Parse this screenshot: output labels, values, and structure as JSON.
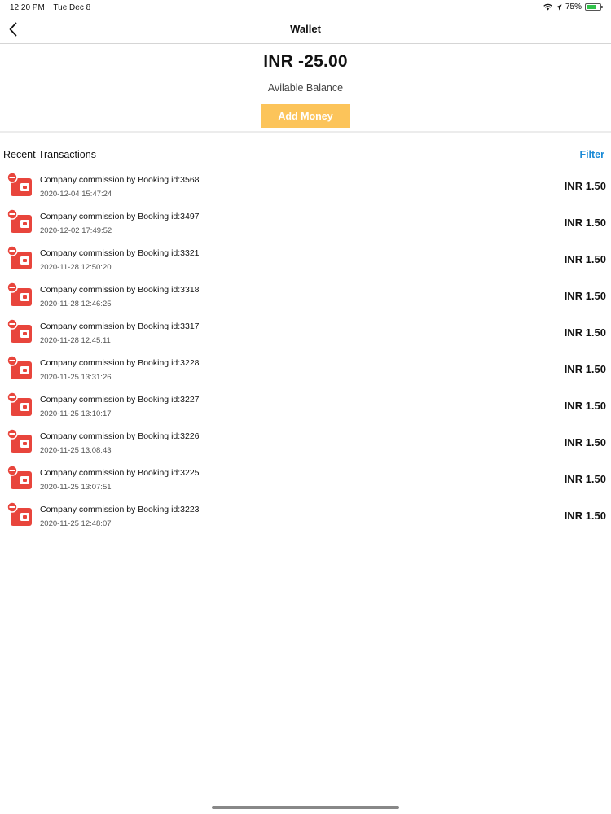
{
  "status_bar": {
    "time": "12:20 PM",
    "date": "Tue Dec 8",
    "battery": "75%",
    "battery_level": 0.75
  },
  "nav": {
    "title": "Wallet"
  },
  "balance": {
    "amount": "INR -25.00",
    "label": "Avilable Balance",
    "add_money_label": "Add Money"
  },
  "transactions_header": {
    "title": "Recent Transactions",
    "filter_label": "Filter"
  },
  "colors": {
    "accent_button": "#fcc45a",
    "link": "#1a8ad6",
    "debit_icon": "#e8453c"
  },
  "transactions": [
    {
      "title": "Company commission by Booking id:3568",
      "datetime": "2020-12-04 15:47:24",
      "amount": "INR 1.50"
    },
    {
      "title": "Company commission by Booking id:3497",
      "datetime": "2020-12-02 17:49:52",
      "amount": "INR 1.50"
    },
    {
      "title": "Company commission by Booking id:3321",
      "datetime": "2020-11-28 12:50:20",
      "amount": "INR 1.50"
    },
    {
      "title": "Company commission by Booking id:3318",
      "datetime": "2020-11-28 12:46:25",
      "amount": "INR 1.50"
    },
    {
      "title": "Company commission by Booking id:3317",
      "datetime": "2020-11-28 12:45:11",
      "amount": "INR 1.50"
    },
    {
      "title": "Company commission by Booking id:3228",
      "datetime": "2020-11-25 13:31:26",
      "amount": "INR 1.50"
    },
    {
      "title": "Company commission by Booking id:3227",
      "datetime": "2020-11-25 13:10:17",
      "amount": "INR 1.50"
    },
    {
      "title": "Company commission by Booking id:3226",
      "datetime": "2020-11-25 13:08:43",
      "amount": "INR 1.50"
    },
    {
      "title": "Company commission by Booking id:3225",
      "datetime": "2020-11-25 13:07:51",
      "amount": "INR 1.50"
    },
    {
      "title": "Company commission by Booking id:3223",
      "datetime": "2020-11-25 12:48:07",
      "amount": "INR 1.50"
    }
  ]
}
